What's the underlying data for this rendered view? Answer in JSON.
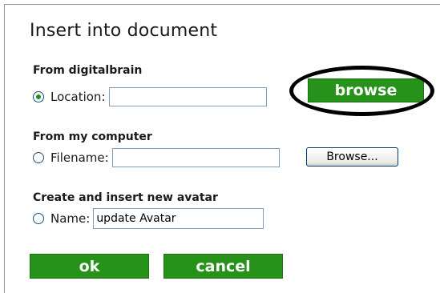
{
  "dialog": {
    "title": "Insert into document",
    "sections": {
      "digitalbrain": {
        "heading": "From digitalbrain",
        "radio_label": "Location:",
        "input_value": "",
        "button_label": "browse"
      },
      "computer": {
        "heading": "From my computer",
        "radio_label": "Filename:",
        "input_value": "",
        "button_label": "Browse..."
      },
      "avatar": {
        "heading": "Create and insert new avatar",
        "radio_label": "Name:",
        "input_value": "update Avatar"
      }
    },
    "actions": {
      "ok_label": "ok",
      "cancel_label": "cancel"
    }
  },
  "colors": {
    "green_button": "#26921a",
    "radio_dot": "#218c2b",
    "annotation_ring": "#000000"
  }
}
